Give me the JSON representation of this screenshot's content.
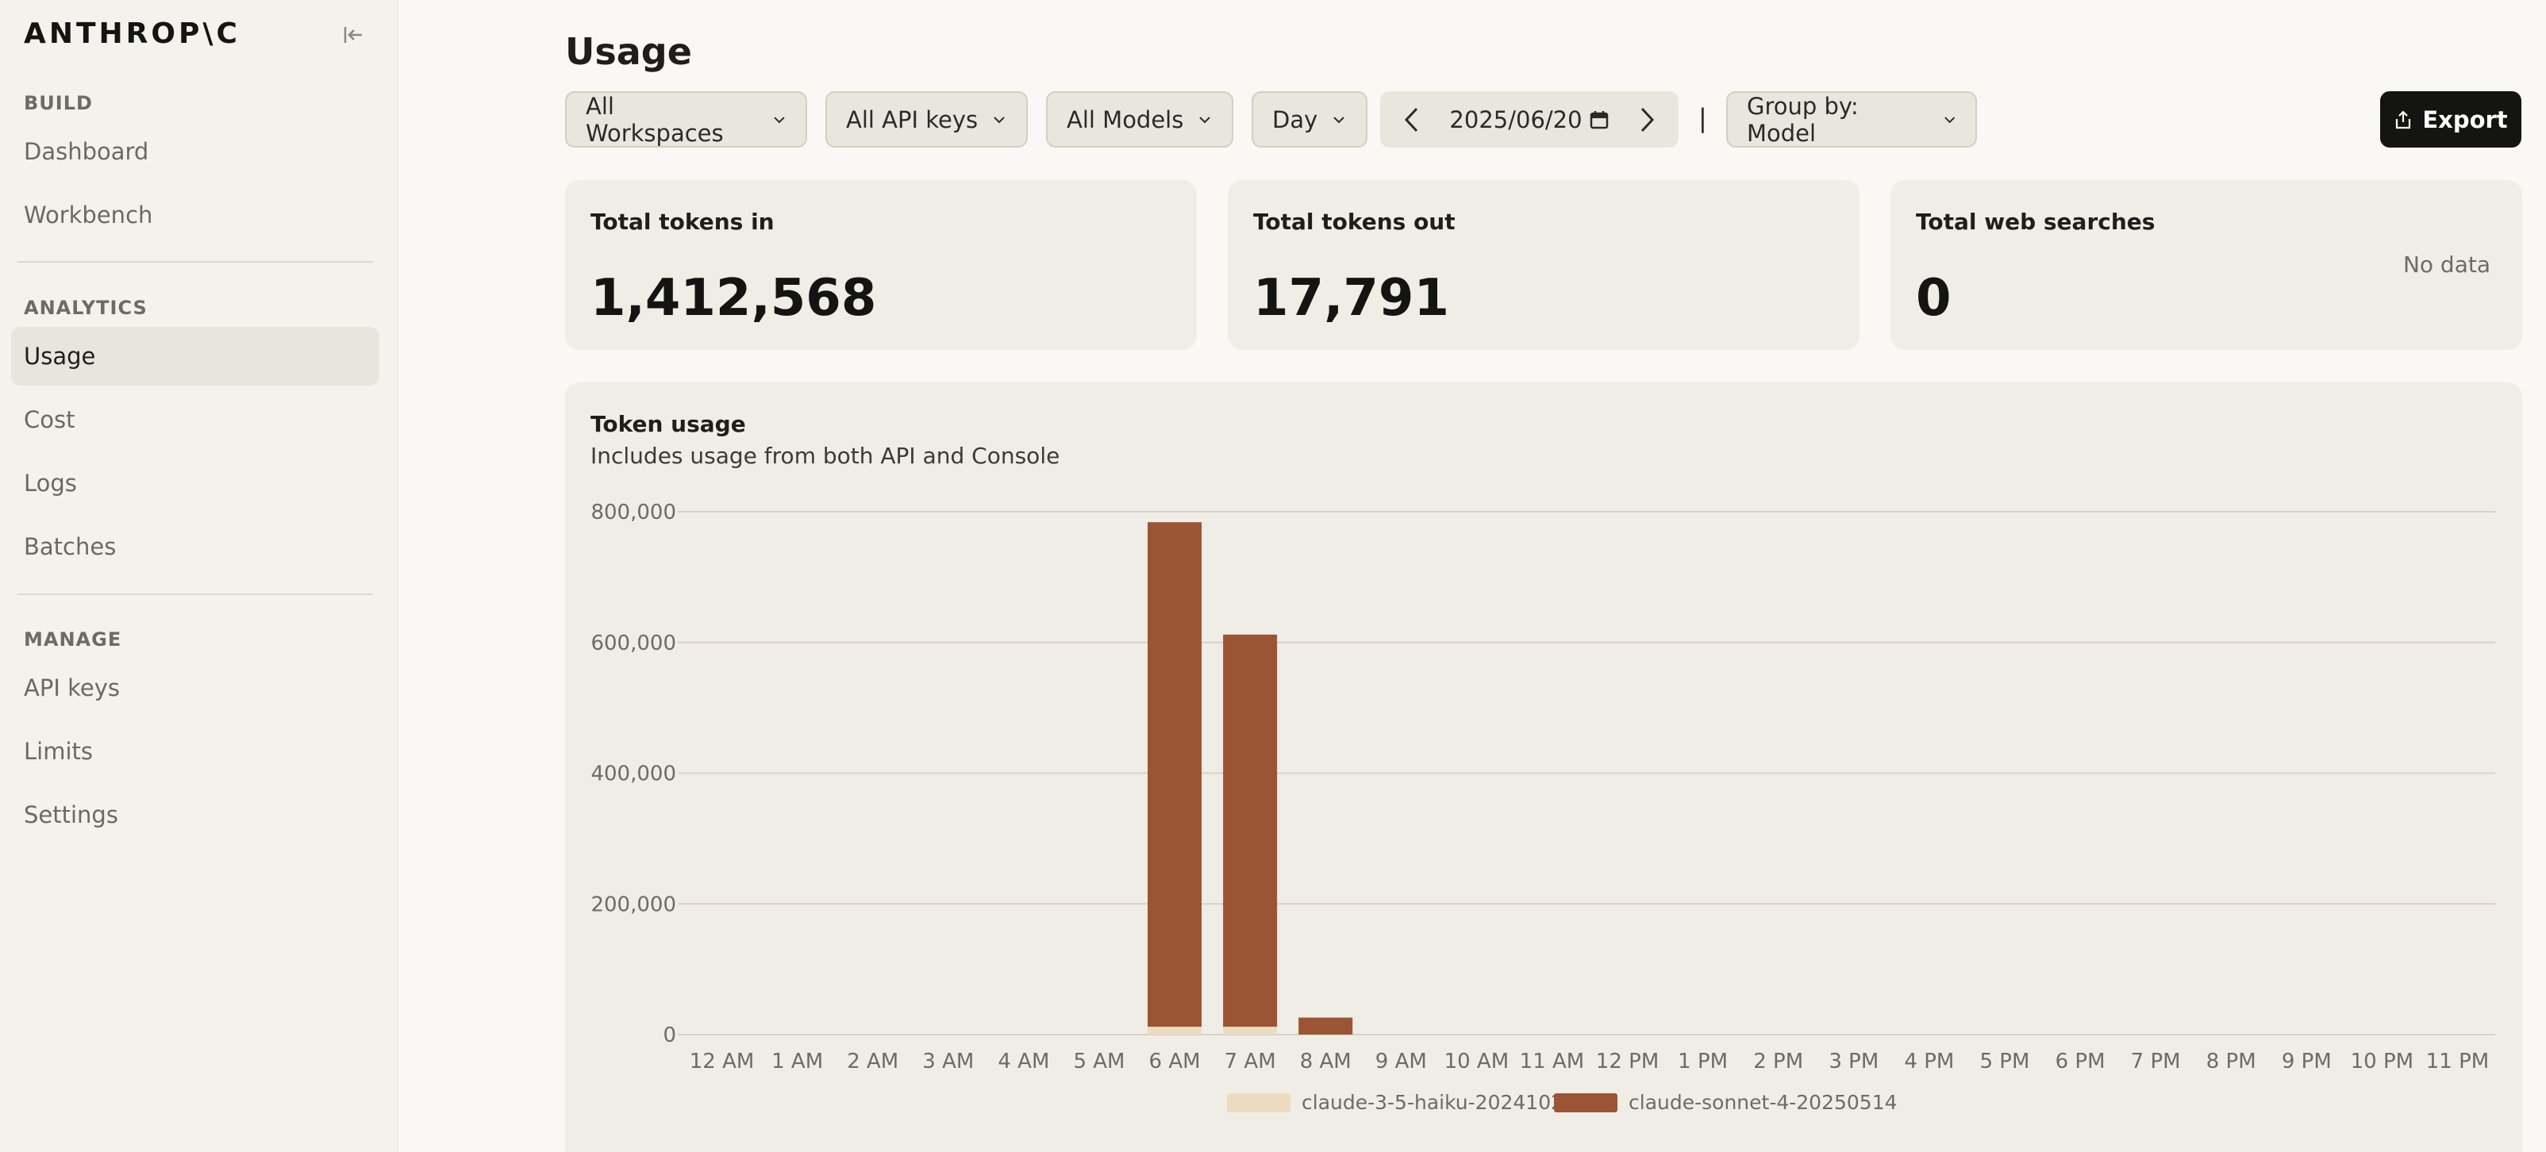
{
  "brand": {
    "logo_text": "ANTHROP\\C"
  },
  "sidebar": {
    "sections": [
      {
        "label": "BUILD",
        "items": [
          "Dashboard",
          "Workbench"
        ]
      },
      {
        "label": "ANALYTICS",
        "items": [
          "Usage",
          "Cost",
          "Logs",
          "Batches"
        ]
      },
      {
        "label": "MANAGE",
        "items": [
          "API keys",
          "Limits",
          "Settings"
        ]
      }
    ],
    "active_item": "Usage"
  },
  "header": {
    "title": "Usage",
    "filters": {
      "workspaces": "All Workspaces",
      "api_keys": "All API keys",
      "models": "All Models",
      "granularity": "Day",
      "date": "2025/06/20",
      "group_by": "Group by: Model"
    },
    "separator": "|",
    "export_label": "Export"
  },
  "stats": {
    "tokens_in": {
      "label": "Total tokens in",
      "value": "1,412,568"
    },
    "tokens_out": {
      "label": "Total tokens out",
      "value": "17,791"
    },
    "web_searches": {
      "label": "Total web searches",
      "value": "0",
      "note": "No data"
    }
  },
  "chart": {
    "title": "Token usage",
    "subtitle": "Includes usage from both API and Console"
  },
  "colors": {
    "haiku": "#ecdcbf",
    "sonnet": "#9b5434",
    "grid": "#d6d2c8",
    "accent_dark": "#141413"
  },
  "chart_data": {
    "type": "bar",
    "stacked": true,
    "categories": [
      "12 AM",
      "1 AM",
      "2 AM",
      "3 AM",
      "4 AM",
      "5 AM",
      "6 AM",
      "7 AM",
      "8 AM",
      "9 AM",
      "10 AM",
      "11 AM",
      "12 PM",
      "1 PM",
      "2 PM",
      "3 PM",
      "4 PM",
      "5 PM",
      "6 PM",
      "7 PM",
      "8 PM",
      "9 PM",
      "10 PM",
      "11 PM"
    ],
    "series": [
      {
        "name": "claude-3-5-haiku-20241022",
        "values": [
          0,
          0,
          0,
          0,
          0,
          0,
          12000,
          12000,
          0,
          0,
          0,
          0,
          0,
          0,
          0,
          0,
          0,
          0,
          0,
          0,
          0,
          0,
          0,
          0
        ]
      },
      {
        "name": "claude-sonnet-4-20250514",
        "values": [
          0,
          0,
          0,
          0,
          0,
          0,
          772000,
          600000,
          26000,
          0,
          0,
          0,
          0,
          0,
          0,
          0,
          0,
          0,
          0,
          0,
          0,
          0,
          0,
          0
        ]
      }
    ],
    "yticks": [
      "0",
      "200,000",
      "400,000",
      "600,000",
      "800,000"
    ],
    "ylim": [
      0,
      800000
    ],
    "grid": true,
    "legend": "bottom-center"
  }
}
